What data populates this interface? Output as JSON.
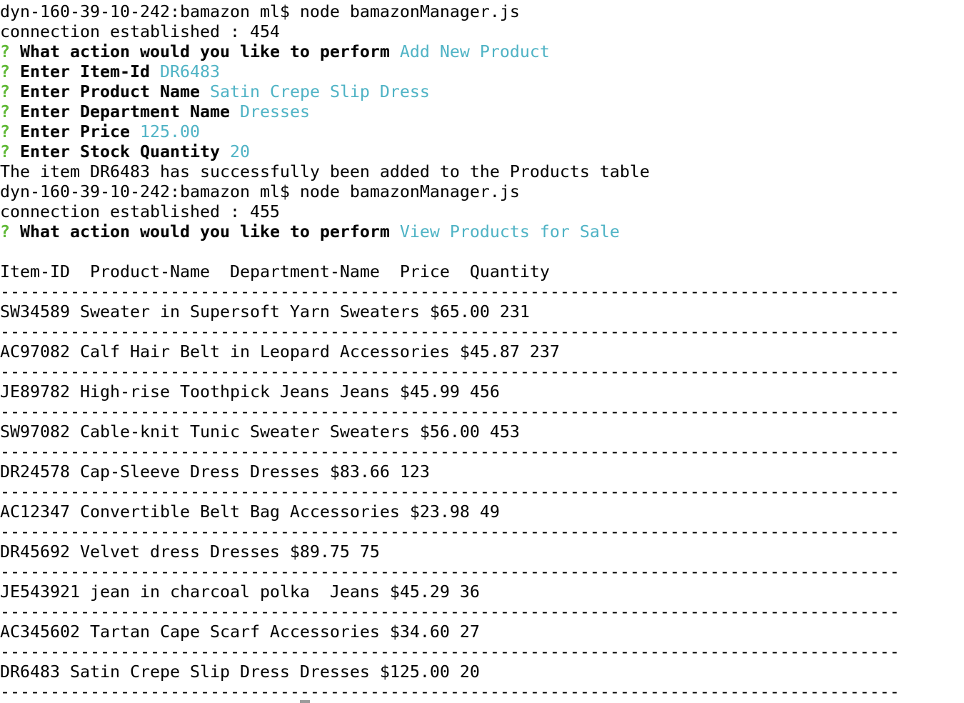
{
  "terminal": {
    "lines": [
      {
        "segments": [
          {
            "t": "dyn-160-39-10-242:bamazon ml$ node bamazonManager.js",
            "s": "plain"
          }
        ]
      },
      {
        "segments": [
          {
            "t": "connection established : 454",
            "s": "plain"
          }
        ]
      },
      {
        "segments": [
          {
            "t": "? ",
            "s": "q"
          },
          {
            "t": "What action would you like to perform ",
            "s": "b"
          },
          {
            "t": "Add New Product",
            "s": "ans"
          }
        ]
      },
      {
        "segments": [
          {
            "t": "? ",
            "s": "q"
          },
          {
            "t": "Enter Item-Id ",
            "s": "b"
          },
          {
            "t": "DR6483",
            "s": "ans"
          }
        ]
      },
      {
        "segments": [
          {
            "t": "? ",
            "s": "q"
          },
          {
            "t": "Enter Product Name ",
            "s": "b"
          },
          {
            "t": "Satin Crepe Slip Dress",
            "s": "ans"
          }
        ]
      },
      {
        "segments": [
          {
            "t": "? ",
            "s": "q"
          },
          {
            "t": "Enter Department Name ",
            "s": "b"
          },
          {
            "t": "Dresses",
            "s": "ans"
          }
        ]
      },
      {
        "segments": [
          {
            "t": "? ",
            "s": "q"
          },
          {
            "t": "Enter Price ",
            "s": "b"
          },
          {
            "t": "125.00",
            "s": "ans"
          }
        ]
      },
      {
        "segments": [
          {
            "t": "? ",
            "s": "q"
          },
          {
            "t": "Enter Stock Quantity ",
            "s": "b"
          },
          {
            "t": "20",
            "s": "ans"
          }
        ]
      },
      {
        "segments": [
          {
            "t": "The item DR6483 has successfully been added to the Products table",
            "s": "plain"
          }
        ]
      },
      {
        "segments": [
          {
            "t": "dyn-160-39-10-242:bamazon ml$ node bamazonManager.js",
            "s": "plain"
          }
        ]
      },
      {
        "segments": [
          {
            "t": "connection established : 455",
            "s": "plain"
          }
        ]
      },
      {
        "segments": [
          {
            "t": "? ",
            "s": "q"
          },
          {
            "t": "What action would you like to perform ",
            "s": "b"
          },
          {
            "t": "View Products for Sale",
            "s": "ans"
          }
        ]
      },
      {
        "segments": []
      },
      {
        "segments": [
          {
            "t": "Item-ID  Product-Name  Department-Name  Price  Quantity",
            "s": "plain"
          }
        ]
      },
      {
        "segments": [
          {
            "t": "------------------------------------------------------------------------------------------",
            "s": "sep"
          }
        ]
      },
      {
        "segments": [
          {
            "t": "SW34589 Sweater in Supersoft Yarn Sweaters $65.00 231",
            "s": "plain"
          }
        ]
      },
      {
        "segments": [
          {
            "t": "------------------------------------------------------------------------------------------",
            "s": "sep"
          }
        ]
      },
      {
        "segments": [
          {
            "t": "AC97082 Calf Hair Belt in Leopard Accessories $45.87 237",
            "s": "plain"
          }
        ]
      },
      {
        "segments": [
          {
            "t": "------------------------------------------------------------------------------------------",
            "s": "sep"
          }
        ]
      },
      {
        "segments": [
          {
            "t": "JE89782 High-rise Toothpick Jeans Jeans $45.99 456",
            "s": "plain"
          }
        ]
      },
      {
        "segments": [
          {
            "t": "------------------------------------------------------------------------------------------",
            "s": "sep"
          }
        ]
      },
      {
        "segments": [
          {
            "t": "SW97082 Cable-knit Tunic Sweater Sweaters $56.00 453",
            "s": "plain"
          }
        ]
      },
      {
        "segments": [
          {
            "t": "------------------------------------------------------------------------------------------",
            "s": "sep"
          }
        ]
      },
      {
        "segments": [
          {
            "t": "DR24578 Cap-Sleeve Dress Dresses $83.66 123",
            "s": "plain"
          }
        ]
      },
      {
        "segments": [
          {
            "t": "------------------------------------------------------------------------------------------",
            "s": "sep"
          }
        ]
      },
      {
        "segments": [
          {
            "t": "AC12347 Convertible Belt Bag Accessories $23.98 49",
            "s": "plain"
          }
        ]
      },
      {
        "segments": [
          {
            "t": "------------------------------------------------------------------------------------------",
            "s": "sep"
          }
        ]
      },
      {
        "segments": [
          {
            "t": "DR45692 Velvet dress Dresses $89.75 75",
            "s": "plain"
          }
        ]
      },
      {
        "segments": [
          {
            "t": "------------------------------------------------------------------------------------------",
            "s": "sep"
          }
        ]
      },
      {
        "segments": [
          {
            "t": "JE543921 jean in charcoal polka  Jeans $45.29 36",
            "s": "plain"
          }
        ]
      },
      {
        "segments": [
          {
            "t": "------------------------------------------------------------------------------------------",
            "s": "sep"
          }
        ]
      },
      {
        "segments": [
          {
            "t": "AC345602 Tartan Cape Scarf Accessories $34.60 27",
            "s": "plain"
          }
        ]
      },
      {
        "segments": [
          {
            "t": "------------------------------------------------------------------------------------------",
            "s": "sep"
          }
        ]
      },
      {
        "segments": [
          {
            "t": "DR6483 Satin Crepe Slip Dress Dresses $125.00 20",
            "s": "plain"
          }
        ]
      },
      {
        "segments": [
          {
            "t": "------------------------------------------------------------------------------------------",
            "s": "sep"
          }
        ]
      }
    ]
  },
  "colors": {
    "prompt_marker": "#5fb936",
    "answer": "#4fb3c5",
    "text": "#000000",
    "cursor": "#9a9a9a"
  }
}
